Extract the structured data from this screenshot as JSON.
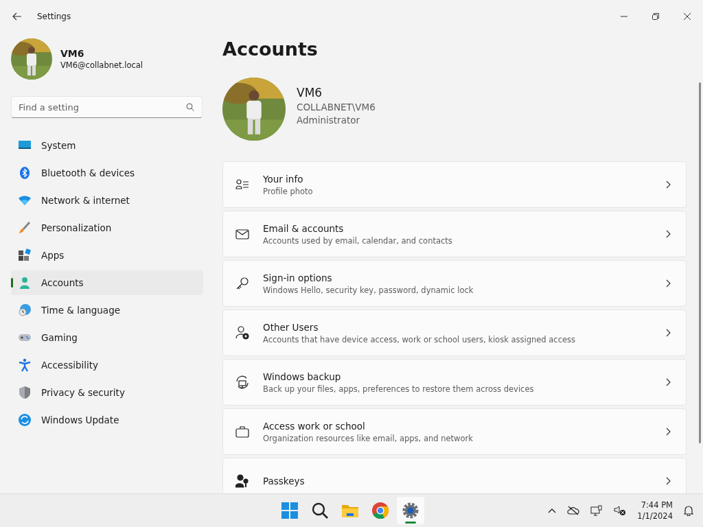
{
  "window": {
    "title": "Settings"
  },
  "user": {
    "name": "VM6",
    "email": "VM6@collabnet.local"
  },
  "search": {
    "placeholder": "Find a setting"
  },
  "sidebar": {
    "items": [
      {
        "label": "System",
        "selected": false
      },
      {
        "label": "Bluetooth & devices",
        "selected": false
      },
      {
        "label": "Network & internet",
        "selected": false
      },
      {
        "label": "Personalization",
        "selected": false
      },
      {
        "label": "Apps",
        "selected": false
      },
      {
        "label": "Accounts",
        "selected": true
      },
      {
        "label": "Time & language",
        "selected": false
      },
      {
        "label": "Gaming",
        "selected": false
      },
      {
        "label": "Accessibility",
        "selected": false
      },
      {
        "label": "Privacy & security",
        "selected": false
      },
      {
        "label": "Windows Update",
        "selected": false
      }
    ]
  },
  "page": {
    "title": "Accounts",
    "profile": {
      "name": "VM6",
      "account": "COLLABNET\\VM6",
      "role": "Administrator"
    },
    "cards": [
      {
        "title": "Your info",
        "subtitle": "Profile photo"
      },
      {
        "title": "Email & accounts",
        "subtitle": "Accounts used by email, calendar, and contacts"
      },
      {
        "title": "Sign-in options",
        "subtitle": "Windows Hello, security key, password, dynamic lock"
      },
      {
        "title": "Other Users",
        "subtitle": "Accounts that have device access, work or school users, kiosk assigned access"
      },
      {
        "title": "Windows backup",
        "subtitle": "Back up your files, apps, preferences to restore them across devices"
      },
      {
        "title": "Access work or school",
        "subtitle": "Organization resources like email, apps, and network"
      },
      {
        "title": "Passkeys"
      }
    ]
  },
  "taskbar": {
    "apps": [
      {
        "selected": false
      },
      {
        "selected": false
      },
      {
        "selected": false
      },
      {
        "selected": false
      },
      {
        "selected": true
      }
    ],
    "time": "7:44 PM",
    "date": "1/1/2024"
  }
}
